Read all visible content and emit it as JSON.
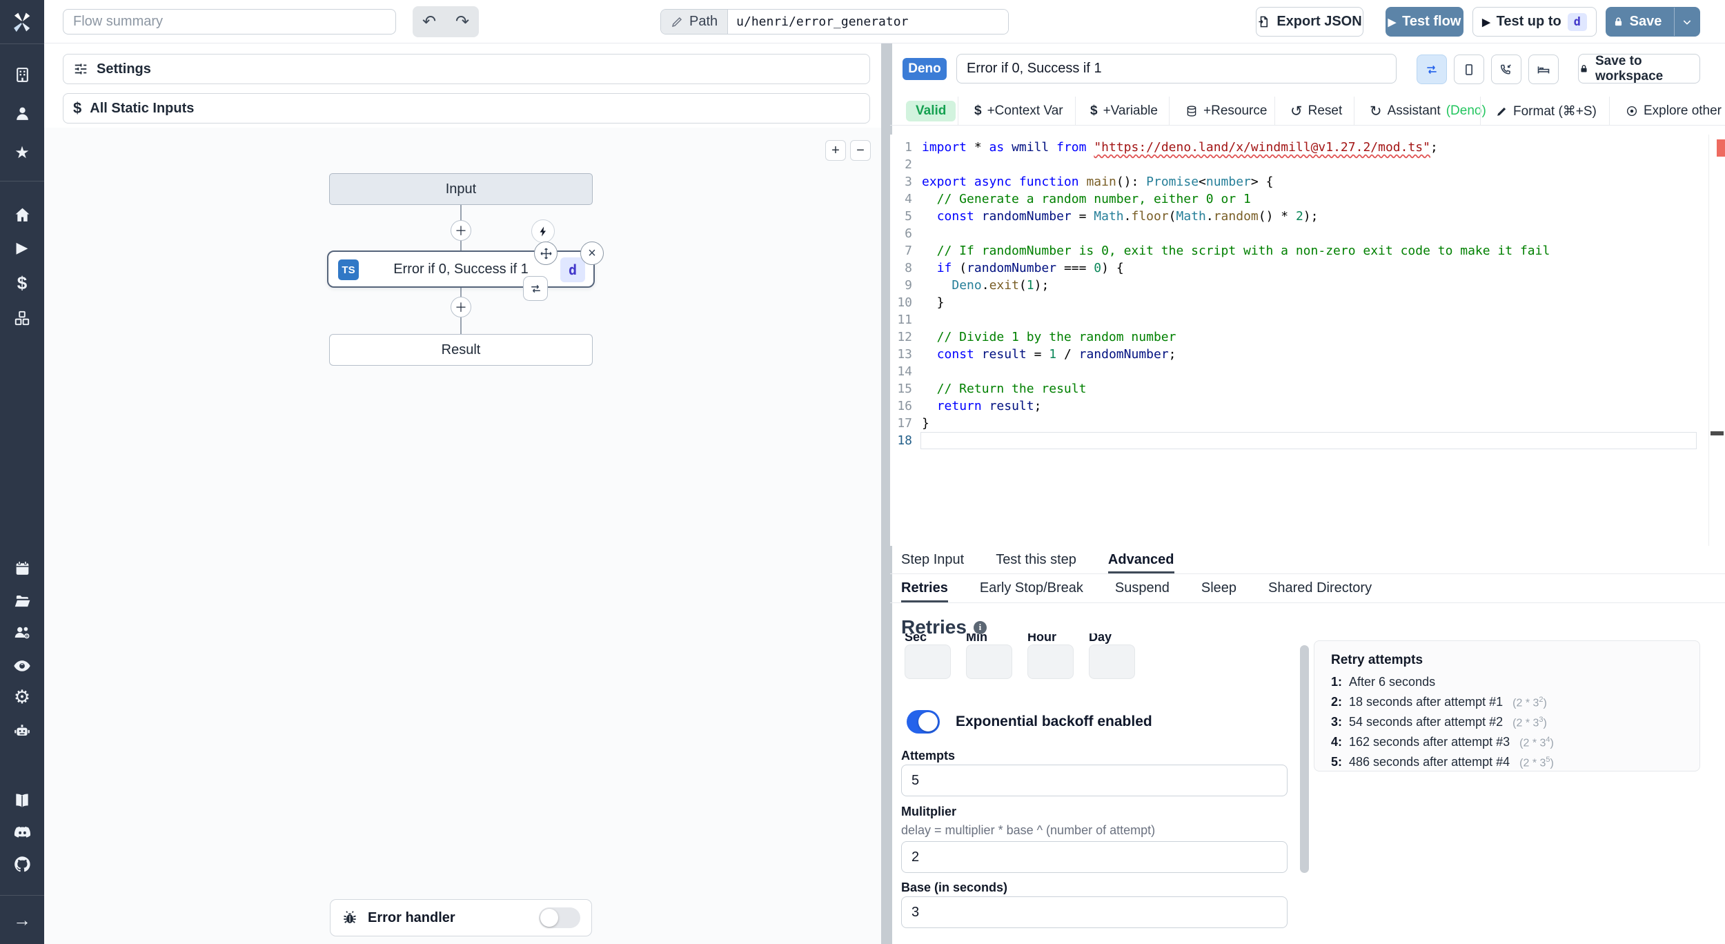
{
  "topbar": {
    "flow_summary_placeholder": "Flow summary",
    "path_label": "Path",
    "path_value": "u/henri/error_generator",
    "export_json": "Export JSON",
    "test_flow": "Test flow",
    "test_up_to": "Test up to",
    "test_up_to_badge": "d",
    "save": "Save"
  },
  "left_panel": {
    "settings": "Settings",
    "all_static_inputs": "All Static Inputs",
    "error_handler": "Error handler",
    "zoom_in": "+",
    "zoom_out": "−",
    "graph": {
      "input_node": "Input",
      "step_lang_badge": "TS",
      "step_title": "Error if 0, Success if 1",
      "step_id_badge": "d",
      "result_node": "Result"
    }
  },
  "step_panel": {
    "lang_badge": "Deno",
    "summary_value": "Error if 0, Success if 1",
    "save_to_workspace": "Save to workspace",
    "toolbar": {
      "valid": "Valid",
      "context_var": "+Context Var",
      "variable": "+Variable",
      "resource": "+Resource",
      "reset": "Reset",
      "assistant": "Assistant",
      "assistant_lang": "(Deno)",
      "format": "Format (⌘+S)",
      "explore": "Explore other s"
    }
  },
  "editor": {
    "current_line": 18,
    "lines": [
      [
        [
          "kw",
          "import"
        ],
        [
          "pl",
          " * "
        ],
        [
          "kw",
          "as"
        ],
        [
          "pl",
          " "
        ],
        [
          "var",
          "wmill"
        ],
        [
          "pl",
          " "
        ],
        [
          "kw",
          "from"
        ],
        [
          "pl",
          " "
        ],
        [
          "sq",
          "\"https://deno.land/x/windmill@v1.27.2/mod.ts\""
        ],
        [
          "pl",
          ";"
        ]
      ],
      [],
      [
        [
          "kw",
          "export"
        ],
        [
          "pl",
          " "
        ],
        [
          "kw",
          "async"
        ],
        [
          "pl",
          " "
        ],
        [
          "kw",
          "function"
        ],
        [
          "pl",
          " "
        ],
        [
          "fn",
          "main"
        ],
        [
          "pl",
          "(): "
        ],
        [
          "type",
          "Promise"
        ],
        [
          "pl",
          "<"
        ],
        [
          "type",
          "number"
        ],
        [
          "pl",
          "> {"
        ]
      ],
      [
        [
          "com",
          "  // Generate a random number, either 0 or 1"
        ]
      ],
      [
        [
          "pl",
          "  "
        ],
        [
          "kw",
          "const"
        ],
        [
          "pl",
          " "
        ],
        [
          "var",
          "randomNumber"
        ],
        [
          "pl",
          " = "
        ],
        [
          "type",
          "Math"
        ],
        [
          "pl",
          "."
        ],
        [
          "fn",
          "floor"
        ],
        [
          "pl",
          "("
        ],
        [
          "type",
          "Math"
        ],
        [
          "pl",
          "."
        ],
        [
          "fn",
          "random"
        ],
        [
          "pl",
          "() * "
        ],
        [
          "num",
          "2"
        ],
        [
          "pl",
          ");"
        ]
      ],
      [],
      [
        [
          "com",
          "  // If randomNumber is 0, exit the script with a non-zero exit code to make it fail"
        ]
      ],
      [
        [
          "pl",
          "  "
        ],
        [
          "kw",
          "if"
        ],
        [
          "pl",
          " ("
        ],
        [
          "var",
          "randomNumber"
        ],
        [
          "pl",
          " === "
        ],
        [
          "num",
          "0"
        ],
        [
          "pl",
          ") {"
        ]
      ],
      [
        [
          "pl",
          "    "
        ],
        [
          "type",
          "Deno"
        ],
        [
          "pl",
          "."
        ],
        [
          "fn",
          "exit"
        ],
        [
          "pl",
          "("
        ],
        [
          "num",
          "1"
        ],
        [
          "pl",
          ");"
        ]
      ],
      [
        [
          "pl",
          "  }"
        ]
      ],
      [],
      [
        [
          "com",
          "  // Divide 1 by the random number"
        ]
      ],
      [
        [
          "pl",
          "  "
        ],
        [
          "kw",
          "const"
        ],
        [
          "pl",
          " "
        ],
        [
          "var",
          "result"
        ],
        [
          "pl",
          " = "
        ],
        [
          "num",
          "1"
        ],
        [
          "pl",
          " / "
        ],
        [
          "var",
          "randomNumber"
        ],
        [
          "pl",
          ";"
        ]
      ],
      [],
      [
        [
          "com",
          "  // Return the result"
        ]
      ],
      [
        [
          "pl",
          "  "
        ],
        [
          "kw",
          "return"
        ],
        [
          "pl",
          " "
        ],
        [
          "var",
          "result"
        ],
        [
          "pl",
          ";"
        ]
      ],
      [
        [
          "pl",
          "}"
        ]
      ],
      []
    ]
  },
  "tabs": {
    "items": [
      "Step Input",
      "Test this step",
      "Advanced"
    ],
    "active": "Advanced"
  },
  "subtabs": {
    "items": [
      "Retries",
      "Early Stop/Break",
      "Suspend",
      "Sleep",
      "Shared Directory"
    ],
    "active": "Retries"
  },
  "retries": {
    "heading": "Retries",
    "time_units": [
      "Sec",
      "Min",
      "Hour",
      "Day"
    ],
    "backoff_label": "Exponential backoff enabled",
    "backoff_enabled": true,
    "attempts_label": "Attempts",
    "attempts_value": "5",
    "multiplier_label": "Mulitplier",
    "multiplier_desc": "delay = multiplier * base ^ (number of attempt)",
    "multiplier_value": "2",
    "base_label": "Base (in seconds)",
    "base_value": "3",
    "card": {
      "title": "Retry attempts",
      "items": [
        {
          "n": "1:",
          "text": "After 6 seconds",
          "formula_pre": "",
          "sup": "",
          "formula_post": ""
        },
        {
          "n": "2:",
          "text": "18 seconds after attempt #1",
          "formula_pre": "(2 * 3",
          "sup": "2",
          "formula_post": ")"
        },
        {
          "n": "3:",
          "text": "54 seconds after attempt #2",
          "formula_pre": "(2 * 3",
          "sup": "3",
          "formula_post": ")"
        },
        {
          "n": "4:",
          "text": "162 seconds after attempt #3",
          "formula_pre": "(2 * 3",
          "sup": "4",
          "formula_post": ")"
        },
        {
          "n": "5:",
          "text": "486 seconds after attempt #4",
          "formula_pre": "(2 * 3",
          "sup": "5",
          "formula_post": ")"
        }
      ]
    }
  },
  "sidebar_icon_names": [
    "windmill-logo",
    "building",
    "user",
    "star",
    "home",
    "play",
    "dollar",
    "boxes",
    "calendar",
    "folder-open",
    "user-group",
    "eye",
    "gear",
    "robot",
    "book-open",
    "discord",
    "github",
    "arrow-right"
  ],
  "colors": {
    "sidebar_bg": "#2d3748",
    "primary_button_blue": "#5c84a8",
    "deno_badge_blue": "#3b7cd6",
    "ts_badge_blue": "#3178c6",
    "id_badge_bg": "#e0e7ff",
    "id_badge_text": "#4338ca",
    "valid_bg": "#d2f3de",
    "valid_text": "#15a151",
    "assistant_green": "#22c55e",
    "toggle_on_blue": "#2563eb",
    "code_keyword": "#0000ff",
    "code_string": "#a31515",
    "code_comment": "#008000",
    "code_number": "#098658",
    "code_type": "#267f99",
    "code_function": "#795e26"
  }
}
